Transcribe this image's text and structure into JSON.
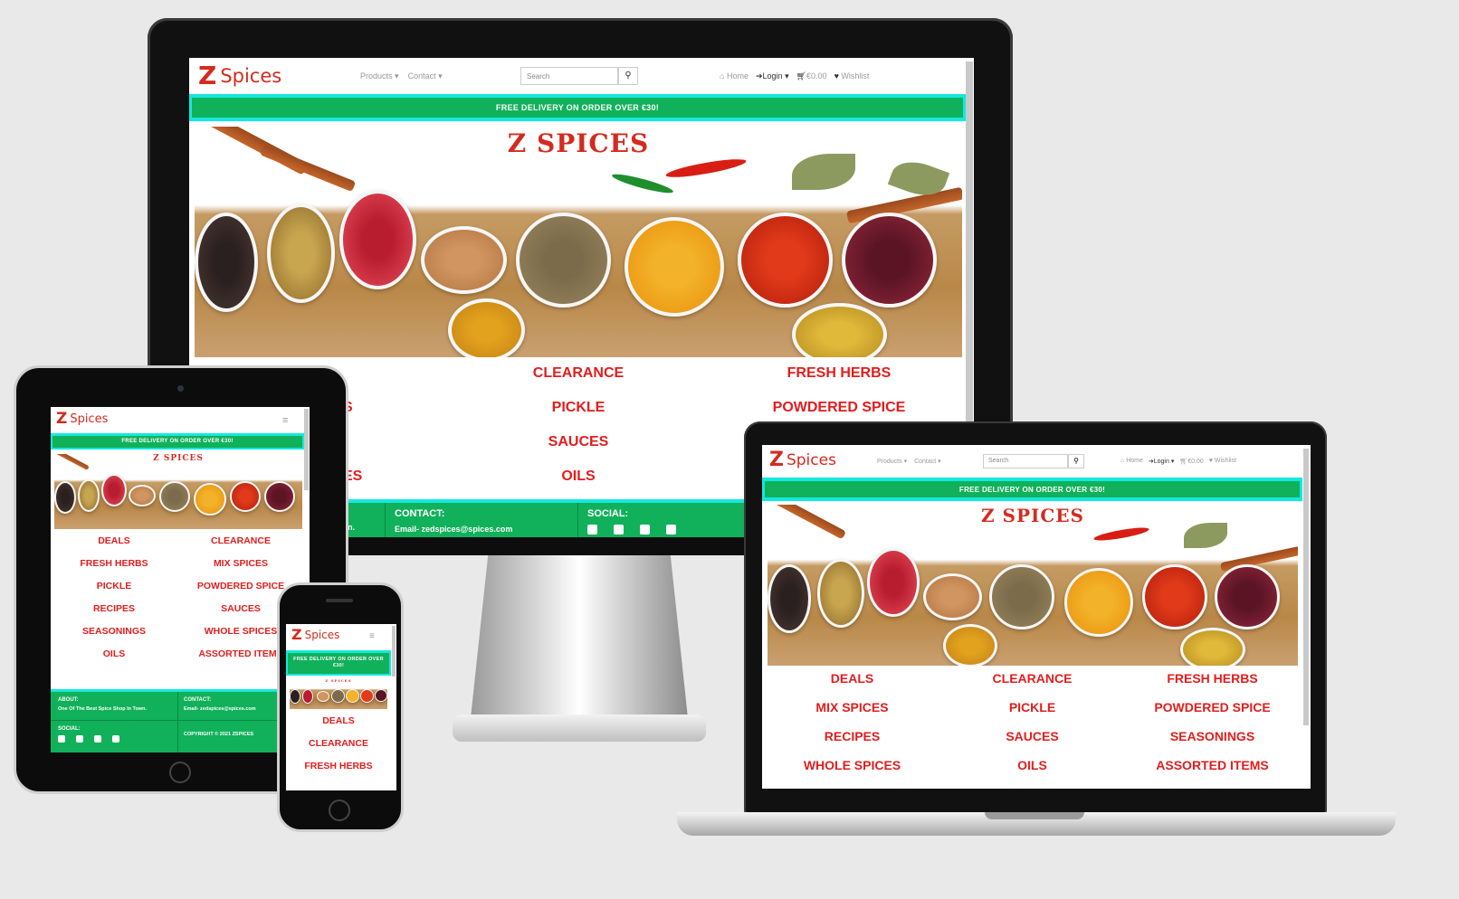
{
  "site": {
    "logo_word": "Spices",
    "nav": {
      "products": "Products",
      "contact": "Contact",
      "home": "Home",
      "login": "Login",
      "cart": "€0.00",
      "wishlist": "Wishlist"
    },
    "search_placeholder": "Search",
    "banner": "FREE DELIVERY ON ORDER OVER €30!",
    "hero_title": "Z SPICES",
    "categories": [
      "DEALS",
      "CLEARANCE",
      "FRESH HERBS",
      "MIX SPICES",
      "PICKLE",
      "POWDERED SPICE",
      "RECIPES",
      "SAUCES",
      "SEASONINGS",
      "WHOLE SPICES",
      "OILS",
      "ASSORTED ITEMS"
    ],
    "footer": {
      "about_label": "ABOUT:",
      "about_text": "One Of The Best Spice Shop In Town.",
      "contact_label": "CONTACT:",
      "contact_text": "Email- zedspices@spices.com",
      "social_label": "SOCIAL:",
      "copyright": "COPYRIGHT © 2021 ZSPICES"
    }
  },
  "monitor_partial": {
    "cat_left_fragment_1": "S",
    "cat_left_fragment_2": "ES",
    "about_fragment": "n.",
    "contact_text_fragment": "Email- zedspices@spices.com"
  },
  "colors": {
    "brand_red": "#d42b1e",
    "category_red": "#e21d1d",
    "banner_green": "#10b15a",
    "banner_cyan": "#14e8e0"
  },
  "icons": [
    "z-logo-icon",
    "caret-down-icon",
    "search-icon",
    "home-icon",
    "login-icon",
    "cart-icon",
    "heart-icon",
    "hamburger-icon",
    "facebook-icon",
    "twitter-icon",
    "instagram-icon",
    "youtube-icon"
  ]
}
